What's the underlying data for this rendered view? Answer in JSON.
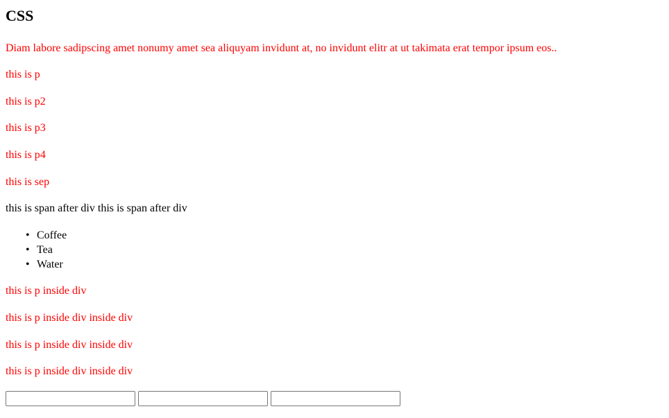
{
  "heading": "CSS",
  "paragraphs": {
    "lorem": "Diam labore sadipscing amet nonumy amet sea aliquyam invidunt at, no invidunt elitr at ut takimata erat tempor ipsum eos..",
    "p": "this is p",
    "p2": "this is p2",
    "p3": "this is p3",
    "p4": "this is p4",
    "sep": "this is sep"
  },
  "span_line": "this is span after div this is span after div",
  "list": {
    "bullet": "•",
    "items": [
      "Coffee",
      "Tea",
      "Water"
    ]
  },
  "div_paragraphs": [
    "this is p inside div",
    "this is p inside div inside div",
    "this is p inside div inside div",
    "this is p inside div inside div"
  ],
  "inputs": [
    {
      "value": "",
      "placeholder": ""
    },
    {
      "value": "",
      "placeholder": ""
    },
    {
      "value": "",
      "placeholder": ""
    }
  ],
  "colors": {
    "text": "#000000",
    "accent_red": "#ff0000"
  }
}
